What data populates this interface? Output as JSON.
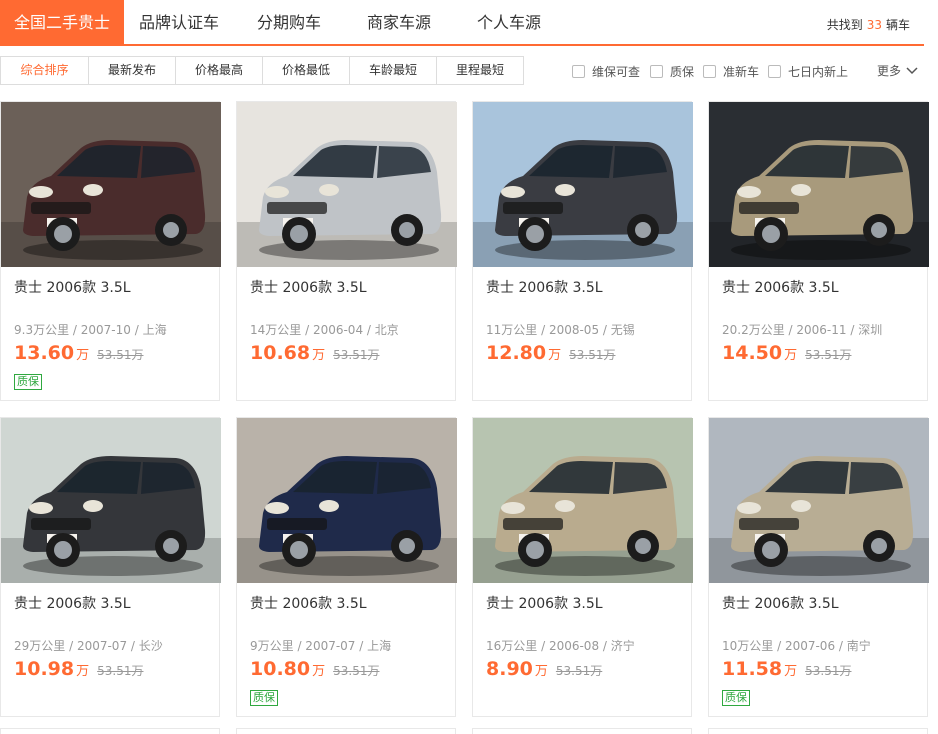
{
  "tabs": [
    {
      "label": "全国二手贵士",
      "active": true
    },
    {
      "label": "品牌认证车",
      "active": false
    },
    {
      "label": "分期购车",
      "active": false
    },
    {
      "label": "商家车源",
      "active": false
    },
    {
      "label": "个人车源",
      "active": false
    }
  ],
  "found": {
    "prefix": "共找到",
    "count": "33",
    "suffix": "辆车"
  },
  "sort_options": [
    {
      "label": "综合排序",
      "active": true
    },
    {
      "label": "最新发布",
      "active": false
    },
    {
      "label": "价格最高",
      "active": false
    },
    {
      "label": "价格最低",
      "active": false
    },
    {
      "label": "车龄最短",
      "active": false
    },
    {
      "label": "里程最短",
      "active": false
    }
  ],
  "filters": [
    {
      "label": "维保可查",
      "checked": false
    },
    {
      "label": "质保",
      "checked": false
    },
    {
      "label": "准新车",
      "checked": false
    },
    {
      "label": "七日内新上",
      "checked": false
    }
  ],
  "more_label": "更多",
  "colors": {
    "accent": "#ff6a32",
    "badge": "#2fa83f"
  },
  "cars": [
    {
      "title": "贵士 2006款 3.5L",
      "meta": "9.3万公里 / 2007-10 / 上海",
      "price": "13.60",
      "unit": "万",
      "orig": "53.51万",
      "badge": "质保",
      "car_color": "#4a2c2c",
      "bg": "#6b6058"
    },
    {
      "title": "贵士 2006款 3.5L",
      "meta": "14万公里 / 2006-04 / 北京",
      "price": "10.68",
      "unit": "万",
      "orig": "53.51万",
      "badge": "",
      "car_color": "#bfc3c7",
      "bg": "#e7e4df"
    },
    {
      "title": "贵士 2006款 3.5L",
      "meta": "11万公里 / 2008-05 / 无锡",
      "price": "12.80",
      "unit": "万",
      "orig": "53.51万",
      "badge": "",
      "car_color": "#3a3c42",
      "bg": "#a9c4dc"
    },
    {
      "title": "贵士 2006款 3.5L",
      "meta": "20.2万公里 / 2006-11 / 深圳",
      "price": "14.50",
      "unit": "万",
      "orig": "53.51万",
      "badge": "",
      "car_color": "#a89a7c",
      "bg": "#2a2e33"
    },
    {
      "title": "贵士 2006款 3.5L",
      "meta": "29万公里 / 2007-07 / 长沙",
      "price": "10.98",
      "unit": "万",
      "orig": "53.51万",
      "badge": "",
      "car_color": "#34363a",
      "bg": "#cfd6d2"
    },
    {
      "title": "贵士 2006款 3.5L",
      "meta": "9万公里 / 2007-07 / 上海",
      "price": "10.80",
      "unit": "万",
      "orig": "53.51万",
      "badge": "质保",
      "car_color": "#1f2a4a",
      "bg": "#b9b2a9"
    },
    {
      "title": "贵士 2006款 3.5L",
      "meta": "16万公里 / 2006-08 / 济宁",
      "price": "8.90",
      "unit": "万",
      "orig": "53.51万",
      "badge": "",
      "car_color": "#b9ab8e",
      "bg": "#b7c4b0"
    },
    {
      "title": "贵士 2006款 3.5L",
      "meta": "10万公里 / 2007-06 / 南宁",
      "price": "11.58",
      "unit": "万",
      "orig": "53.51万",
      "badge": "质保",
      "car_color": "#b8ad94",
      "bg": "#b0b7bf"
    }
  ]
}
